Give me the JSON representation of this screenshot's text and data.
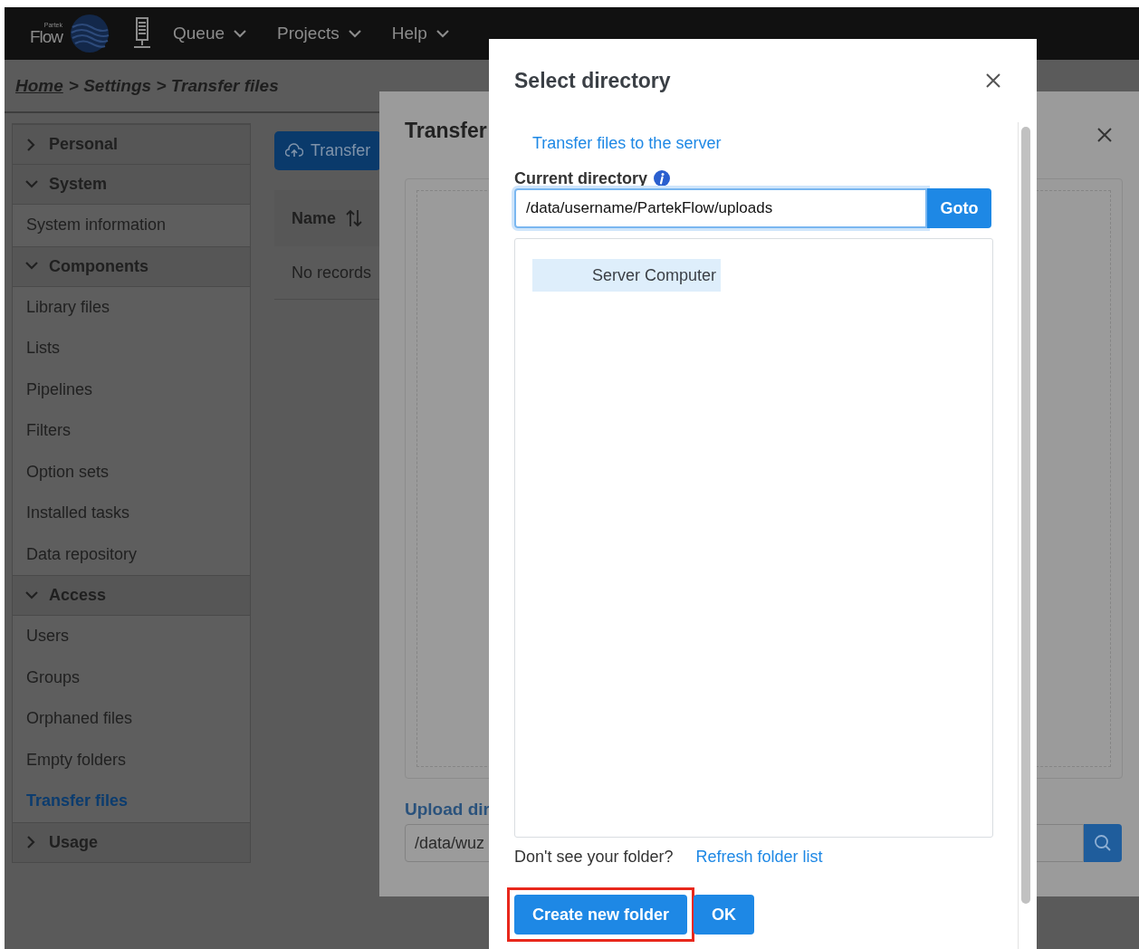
{
  "navbar": {
    "logo_small": "Partek",
    "logo": "Flow",
    "menus": [
      {
        "label": "Queue"
      },
      {
        "label": "Projects"
      },
      {
        "label": "Help"
      }
    ]
  },
  "breadcrumb": {
    "home": "Home",
    "trail": "> Settings > Transfer files"
  },
  "sidebar": [
    {
      "label": "Personal",
      "expanded": false
    },
    {
      "label": "System",
      "expanded": true,
      "children": [
        {
          "label": "System information",
          "selected": false
        }
      ]
    },
    {
      "label": "Components",
      "expanded": true,
      "children": [
        {
          "label": "Library files",
          "selected": false
        },
        {
          "label": "Lists",
          "selected": false
        },
        {
          "label": "Pipelines",
          "selected": false
        },
        {
          "label": "Filters",
          "selected": false
        },
        {
          "label": "Option sets",
          "selected": false
        },
        {
          "label": "Installed tasks",
          "selected": false
        },
        {
          "label": "Data repository",
          "selected": false
        }
      ]
    },
    {
      "label": "Access",
      "expanded": true,
      "children": [
        {
          "label": "Users",
          "selected": false
        },
        {
          "label": "Groups",
          "selected": false
        },
        {
          "label": "Orphaned files",
          "selected": false
        },
        {
          "label": "Empty folders",
          "selected": false
        },
        {
          "label": "Transfer files",
          "selected": true
        }
      ]
    },
    {
      "label": "Usage",
      "expanded": false
    }
  ],
  "content": {
    "transfer_button": "Transfer",
    "table": {
      "columns": [
        "Name"
      ],
      "empty_text": "No records"
    }
  },
  "transfer_dialog": {
    "title": "Transfer",
    "upload_label": "Upload dir",
    "upload_value": "/data/wuz"
  },
  "select_dialog": {
    "title": "Select directory",
    "link": "Transfer files to the server",
    "current_label": "Current directory",
    "path": "/data/username/PartekFlow/uploads",
    "goto": "Goto",
    "folders": [
      {
        "label": "Server Computer",
        "selected": true
      }
    ],
    "hint": "Don't see your folder?",
    "refresh": "Refresh folder list",
    "buttons": [
      {
        "label": "Create new folder",
        "highlighted": true
      },
      {
        "label": "OK",
        "highlighted": false
      }
    ]
  }
}
